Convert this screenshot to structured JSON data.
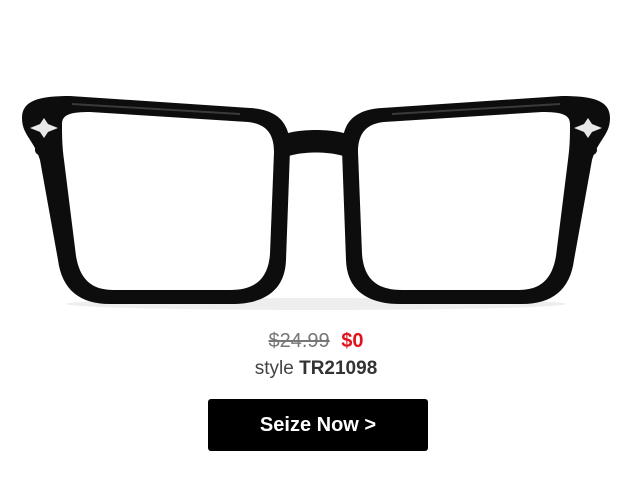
{
  "product": {
    "image_alt": "black square eyeglasses frame",
    "old_price": "$24.99",
    "new_price": "$0",
    "style_label": "style",
    "style_code": "TR21098"
  },
  "cta": {
    "label": "Seize Now >"
  },
  "colors": {
    "sale_price": "#e0141e",
    "button_bg": "#000000",
    "button_text": "#ffffff"
  }
}
